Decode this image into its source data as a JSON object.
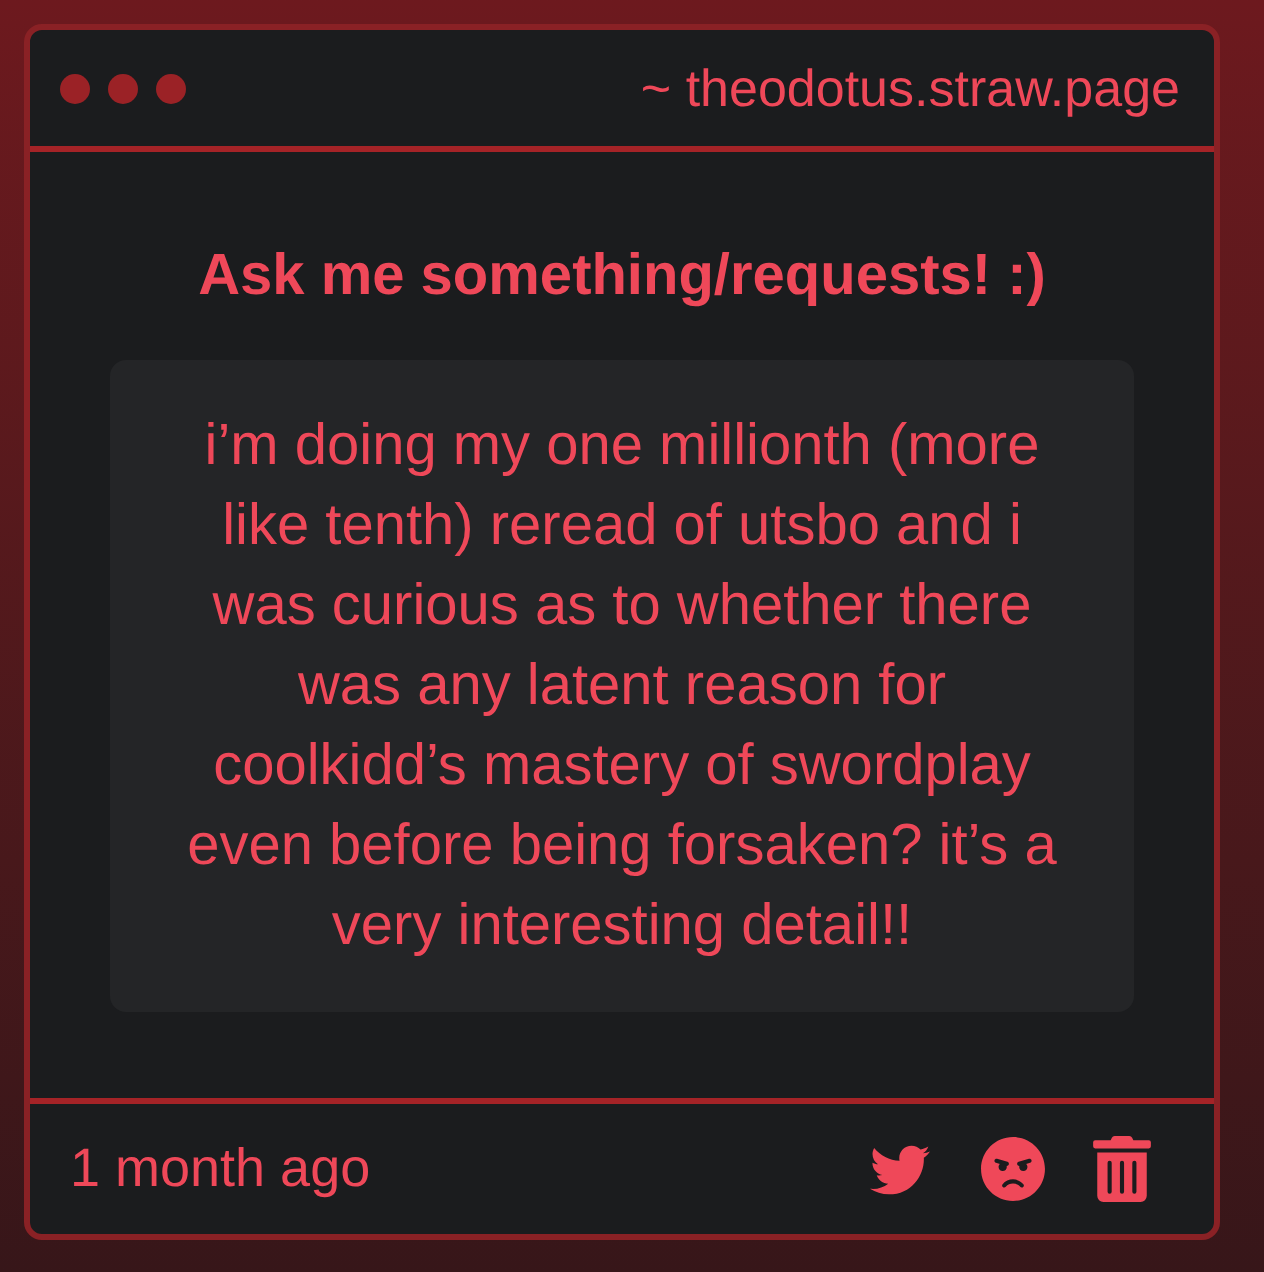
{
  "window": {
    "title": "~ theodotus.straw.page"
  },
  "card": {
    "heading": "Ask me something/requests! :)",
    "question": "i’m doing my one millionth (more like tenth) reread of utsbo and i was curious as to whether there was any latent reason for coolkidd’s mastery of swordplay even before being forsaken? it’s a very interesting detail!!"
  },
  "footer": {
    "time": "1 month ago"
  }
}
